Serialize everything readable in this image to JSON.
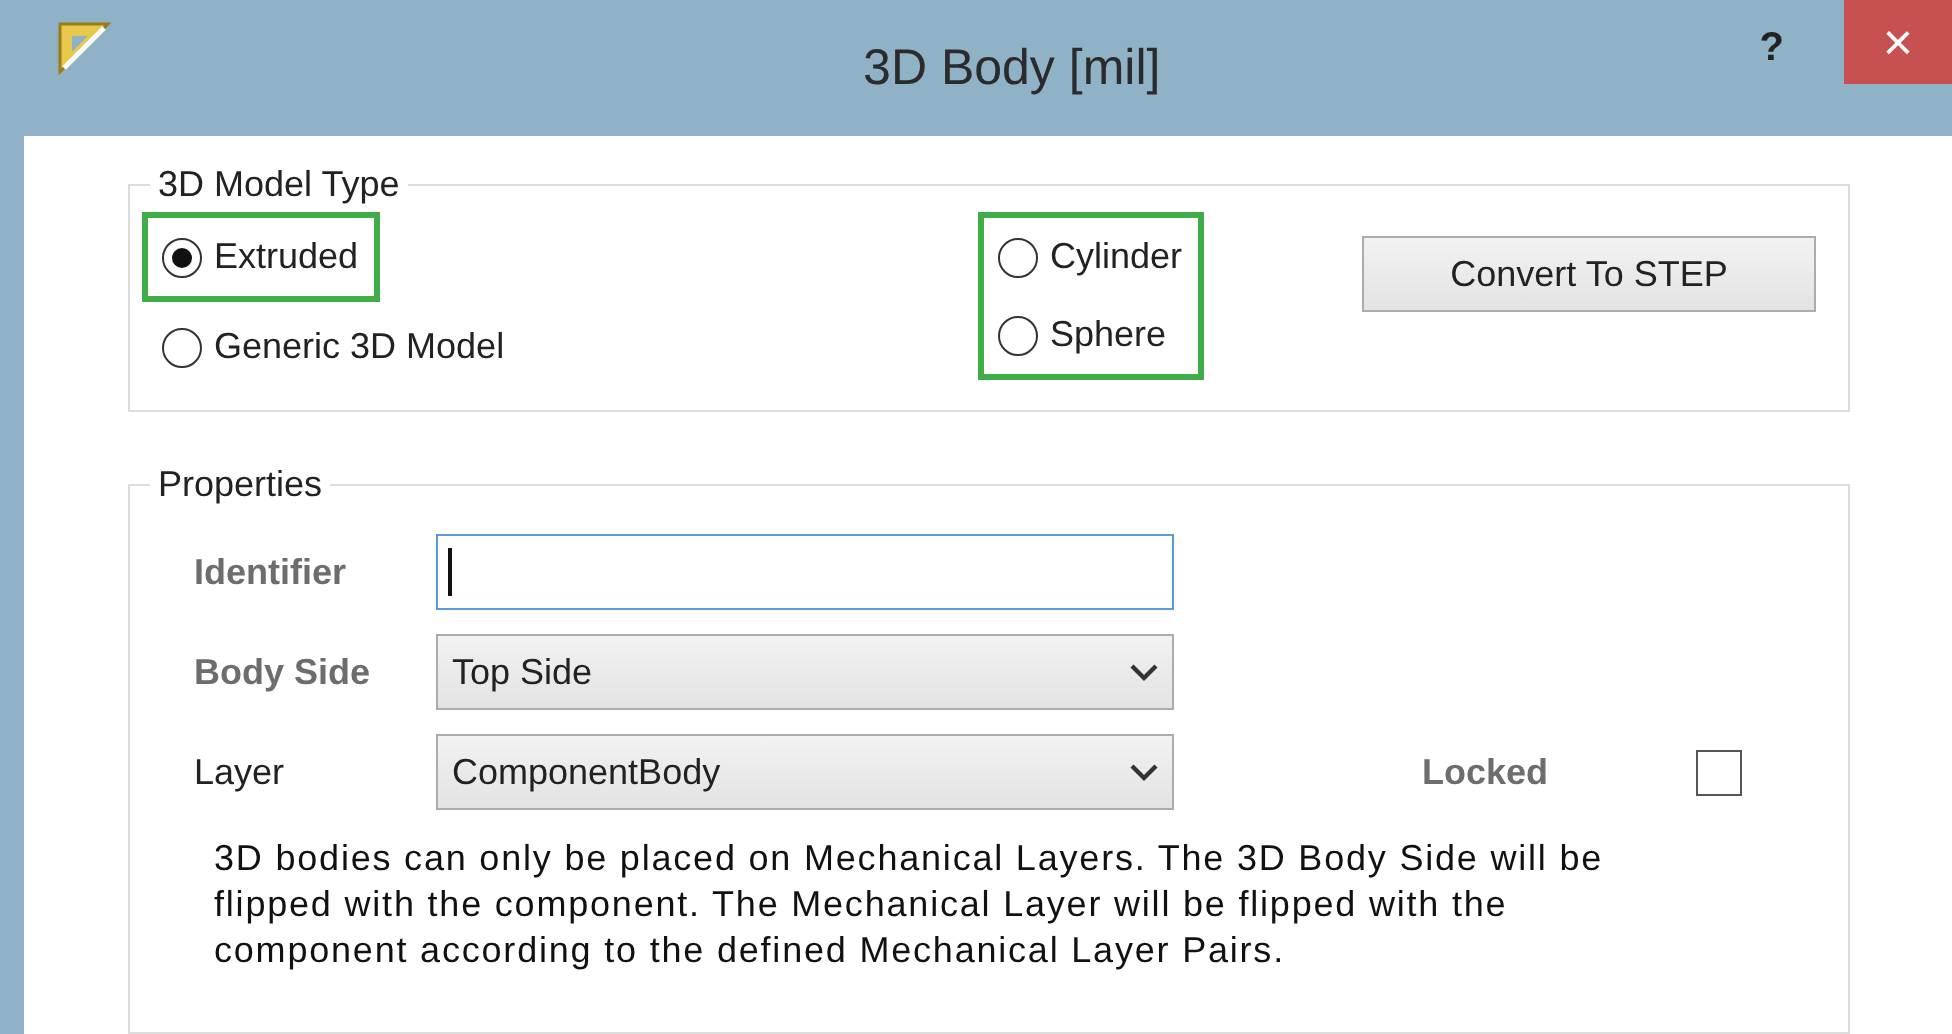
{
  "window": {
    "title": "3D Body [mil]",
    "help": "?",
    "close": "×"
  },
  "model_type": {
    "legend": "3D Model Type",
    "columns": [
      {
        "options": [
          {
            "label": "Extruded",
            "selected": true,
            "highlighted": true
          },
          {
            "label": "Generic 3D Model",
            "selected": false,
            "highlighted": false
          }
        ]
      },
      {
        "options": [
          {
            "label": "Cylinder",
            "selected": false,
            "highlighted": true
          },
          {
            "label": "Sphere",
            "selected": false,
            "highlighted": true
          }
        ]
      }
    ],
    "button": "Convert To STEP"
  },
  "properties": {
    "legend": "Properties",
    "fields": [
      {
        "kind": "text",
        "label": "Identifier",
        "dimmed": true,
        "focused": true
      },
      {
        "kind": "dropdown",
        "label": "Body Side",
        "value": "Top Side",
        "dimmed": true,
        "focused": false
      },
      {
        "kind": "dropdown",
        "label": "Layer",
        "value": "ComponentBody",
        "dimmed": false,
        "focused": false
      }
    ],
    "locked": {
      "label": "Locked",
      "checked": false,
      "dimmed": true
    },
    "note": "3D bodies can only be placed on Mechanical Layers. The 3D Body Side will be flipped with the component. The Mechanical Layer will be flipped with the component according to the defined Mechanical Layer Pairs."
  }
}
